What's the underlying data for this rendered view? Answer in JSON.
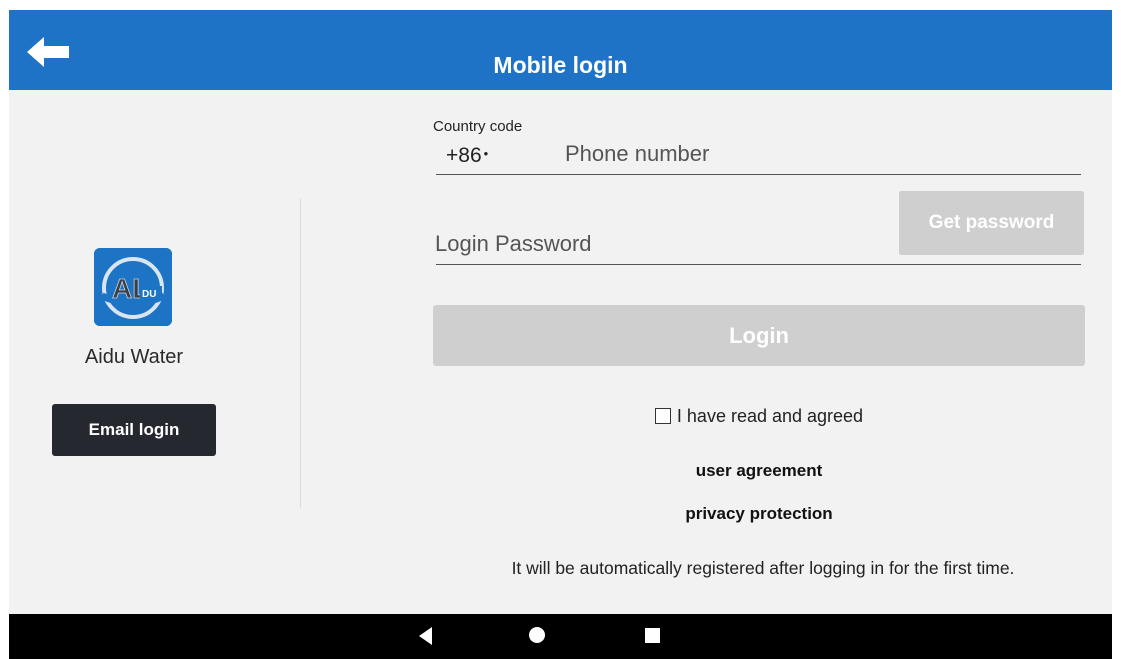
{
  "header": {
    "title": "Mobile login",
    "back_icon": "arrow-left-icon",
    "background": "#1f73c7"
  },
  "app": {
    "name": "Aidu Water",
    "logo_icon": "aidu-water-logo"
  },
  "left": {
    "email_login_label": "Email login"
  },
  "form": {
    "country_code_label": "Country code",
    "country_code_value": "+86",
    "country_code_caret": "•",
    "phone_placeholder": "Phone number",
    "password_placeholder": "Login Password",
    "get_password_label": "Get password",
    "login_label": "Login",
    "agree_label": "I have read and agreed",
    "user_agreement_label": "user agreement",
    "privacy_label": "privacy protection",
    "auto_register_note": "It will be automatically registered after logging in for the first time."
  },
  "navbar": {
    "back_icon": "nav-back-icon",
    "home_icon": "nav-home-icon",
    "recents_icon": "nav-recents-icon"
  },
  "colors": {
    "accent": "#1f73c7",
    "disabled_button": "#cfcfcf",
    "dark_button": "#25282f",
    "background": "#f2f2f2"
  }
}
